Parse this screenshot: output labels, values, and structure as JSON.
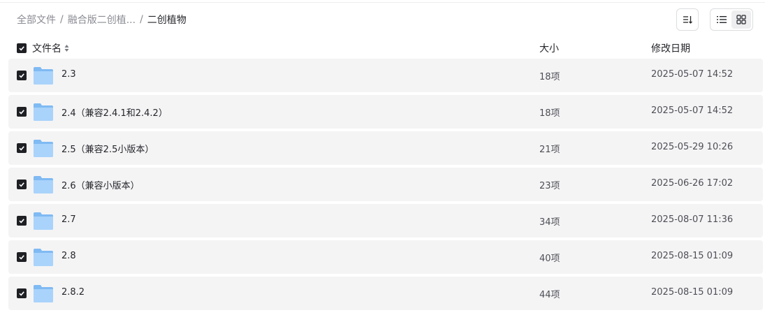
{
  "breadcrumb": {
    "root": "全部文件",
    "parent": "融合版二创植...",
    "sep": "/",
    "current": "二创植物"
  },
  "toolbar": {
    "sort_icon": "sort-desc-icon",
    "view_list_icon": "list-view-icon",
    "view_grid_icon": "grid-view-icon",
    "active_view": "list"
  },
  "table": {
    "headers": {
      "name": "文件名",
      "size": "大小",
      "date": "修改日期"
    },
    "rows": [
      {
        "name": "2.3",
        "size": "18项",
        "date": "2025-05-07 14:52",
        "checked": true
      },
      {
        "name": "2.4（兼容2.4.1和2.4.2）",
        "size": "18项",
        "date": "2025-05-07 14:52",
        "checked": true
      },
      {
        "name": "2.5（兼容2.5小版本）",
        "size": "21项",
        "date": "2025-05-29 10:26",
        "checked": true
      },
      {
        "name": "2.6（兼容小版本）",
        "size": "23项",
        "date": "2025-06-26 17:02",
        "checked": true
      },
      {
        "name": "2.7",
        "size": "34项",
        "date": "2025-08-07 11:36",
        "checked": true
      },
      {
        "name": "2.8",
        "size": "40项",
        "date": "2025-08-15 01:09",
        "checked": true
      },
      {
        "name": "2.8.2",
        "size": "44项",
        "date": "2025-08-15 01:09",
        "checked": true
      }
    ]
  },
  "colors": {
    "row_bg": "#f4f4f5",
    "checkbox": "#1f2024",
    "folder_light": "#a9d3fb",
    "folder_dark": "#7fbaf3"
  }
}
